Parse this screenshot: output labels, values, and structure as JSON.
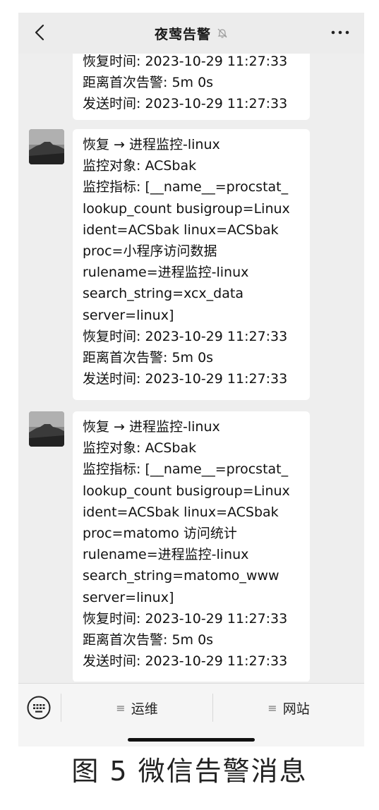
{
  "header": {
    "title": "夜莺告警",
    "back_icon": "chevron-left-icon",
    "mute_icon": "bell-off-icon",
    "more_icon": "more-horizontal-icon"
  },
  "messages": [
    {
      "lines": [
        "恢复时间: 2023-10-29 11:27:33",
        "距离首次告警: 5m 0s",
        "发送时间: 2023-10-29 11:27:33"
      ]
    },
    {
      "lines": [
        "恢复 → 进程监控-linux",
        "监控对象: ACSbak",
        "监控指标: [__name__=procstat_",
        "lookup_count busigroup=Linux",
        "ident=ACSbak linux=ACSbak",
        "proc=小程序访问数据",
        "rulename=进程监控-linux",
        "search_string=xcx_data",
        "server=linux]",
        "恢复时间: 2023-10-29 11:27:33",
        "距离首次告警: 5m 0s",
        "发送时间: 2023-10-29 11:27:33"
      ]
    },
    {
      "lines": [
        "恢复 → 进程监控-linux",
        "监控对象: ACSbak",
        "监控指标: [__name__=procstat_",
        "lookup_count busigroup=Linux",
        "ident=ACSbak linux=ACSbak",
        "proc=matomo 访问统计",
        "rulename=进程监控-linux",
        "search_string=matomo_www",
        "server=linux]",
        "恢复时间: 2023-10-29 11:27:33",
        "距离首次告警: 5m 0s",
        "发送时间: 2023-10-29 11:27:33"
      ]
    }
  ],
  "bottom_bar": {
    "keyboard_icon": "keyboard-icon",
    "menu1_label": "运维",
    "menu2_label": "网站",
    "menu_icon": "≡"
  },
  "caption": "图 5   微信告警消息"
}
